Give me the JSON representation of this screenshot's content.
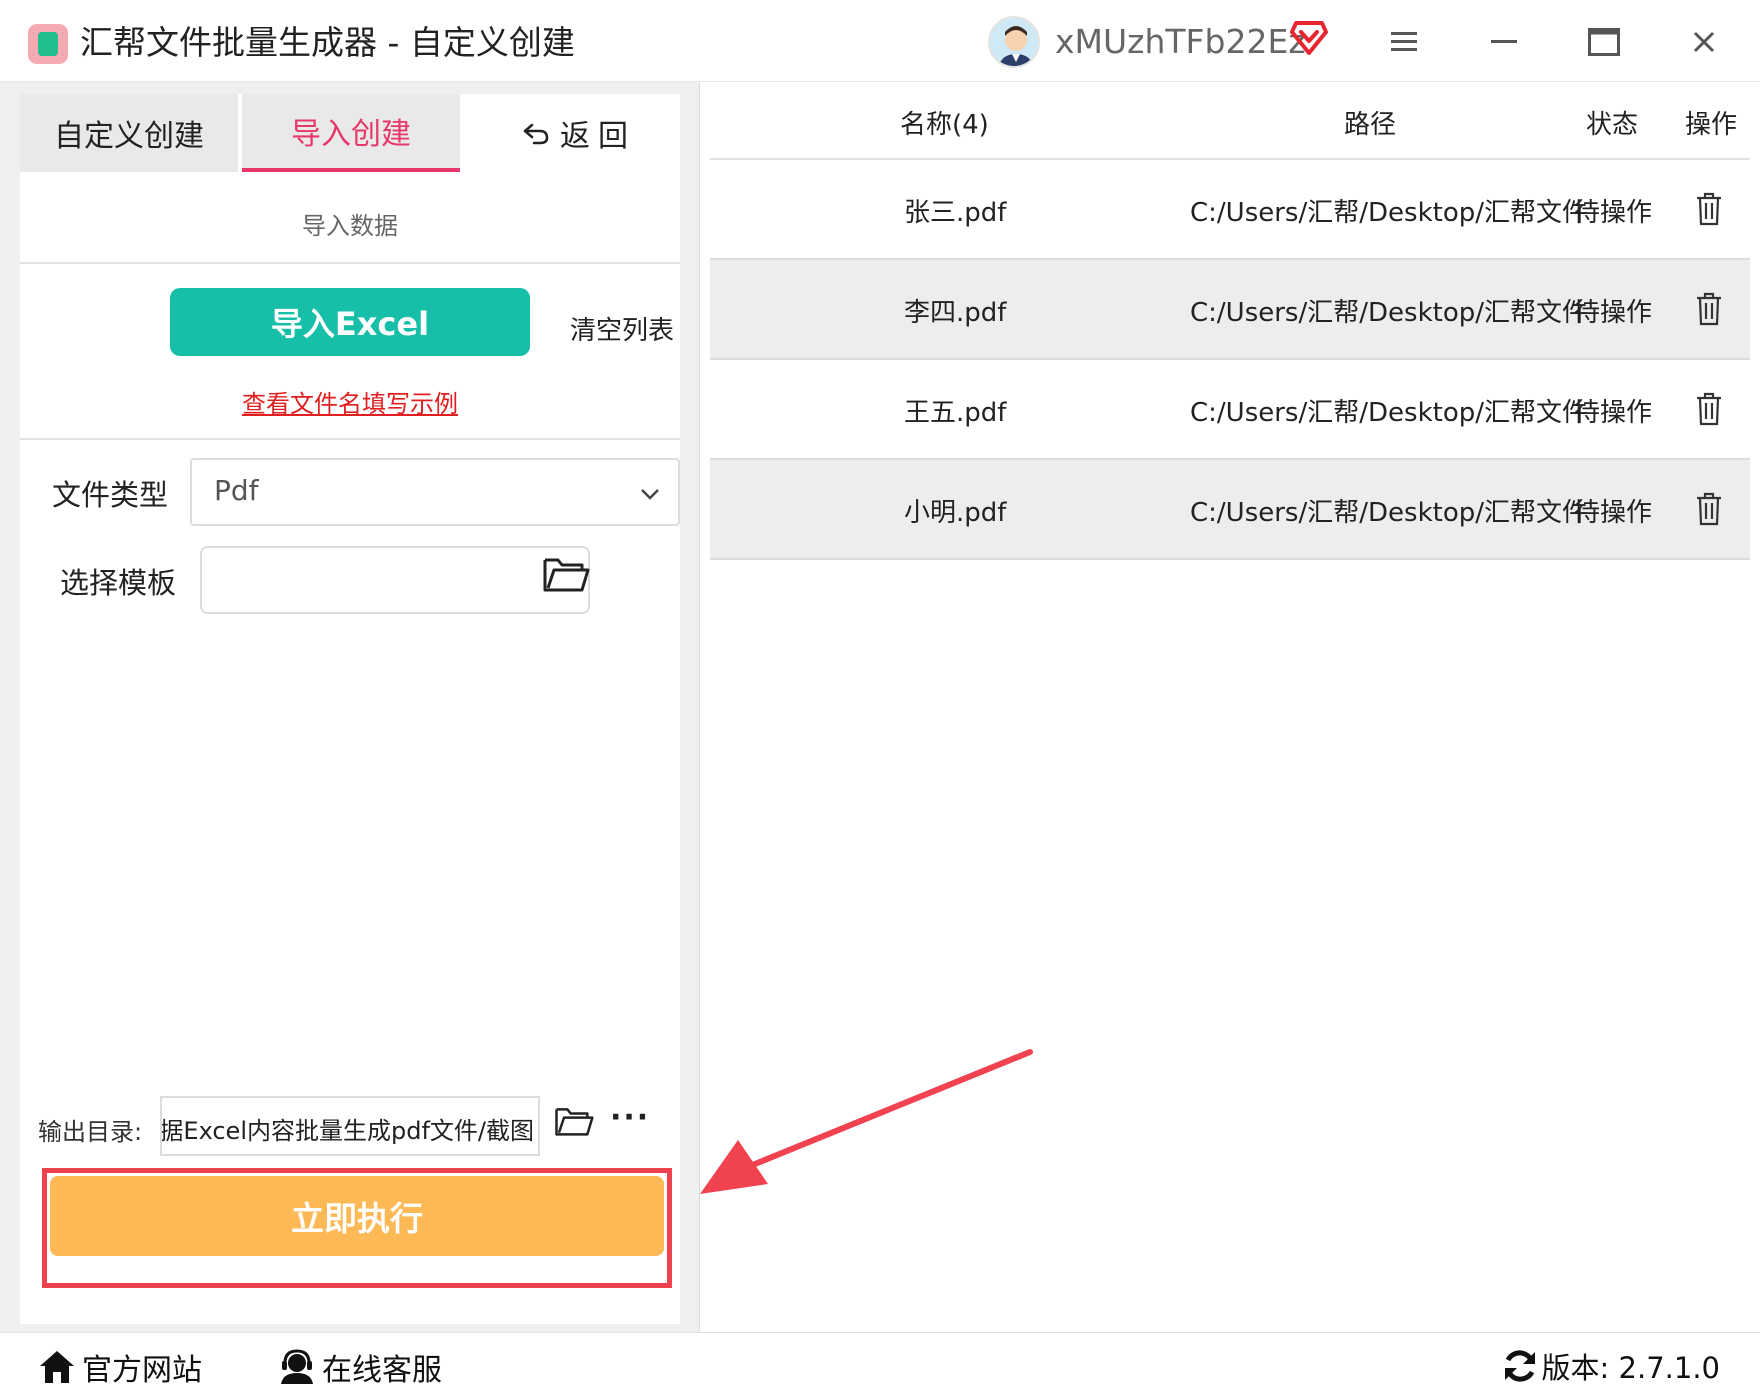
{
  "app": {
    "title": "汇帮文件批量生成器 - 自定义创建",
    "username": "xMUzhTFb22Ez"
  },
  "left": {
    "tabs": [
      "自定义创建",
      "导入创建",
      "返回"
    ],
    "active_tab": "导入创建",
    "section_title": "导入数据",
    "import_button": "导入Excel",
    "clear_list": "清空列表",
    "example_link": "查看文件名填写示例",
    "file_type_label": "文件类型",
    "file_type_value": "Pdf",
    "template_label": "选择模板",
    "template_value": "",
    "output_label": "输出目录:",
    "output_value": "据Excel内容批量生成pdf文件/截图",
    "more_label": "···",
    "execute_button": "立即执行"
  },
  "table": {
    "headers": [
      "名称(4)",
      "路径",
      "状态",
      "操作"
    ],
    "rows": [
      {
        "name": "张三.pdf",
        "path": "C:/Users/汇帮/Desktop/汇帮文件",
        "status": "待操作"
      },
      {
        "name": "李四.pdf",
        "path": "C:/Users/汇帮/Desktop/汇帮文件",
        "status": "待操作"
      },
      {
        "name": "王五.pdf",
        "path": "C:/Users/汇帮/Desktop/汇帮文件",
        "status": "待操作"
      },
      {
        "name": "小明.pdf",
        "path": "C:/Users/汇帮/Desktop/汇帮文件",
        "status": "待操作"
      }
    ]
  },
  "footer": {
    "website": "官方网站",
    "support": "在线客服",
    "version": "版本: 2.7.1.0"
  },
  "colors": {
    "accent_pink": "#e8386b",
    "import_green": "#17bea8",
    "execute_orange": "#fdb955",
    "highlight_red": "#f0424f",
    "link_red": "#e02020"
  },
  "icons": {
    "app": "app-logo-icon",
    "user": "avatar-icon",
    "vip": "vip-heart-icon",
    "menu": "menu-icon",
    "minimize": "minimize-icon",
    "maximize": "maximize-icon",
    "close": "close-icon",
    "back": "back-arrow-icon",
    "chevron": "chevron-down-icon",
    "folder": "folder-icon",
    "trash": "trash-icon",
    "home": "home-icon",
    "support": "support-agent-icon",
    "refresh": "refresh-icon"
  }
}
